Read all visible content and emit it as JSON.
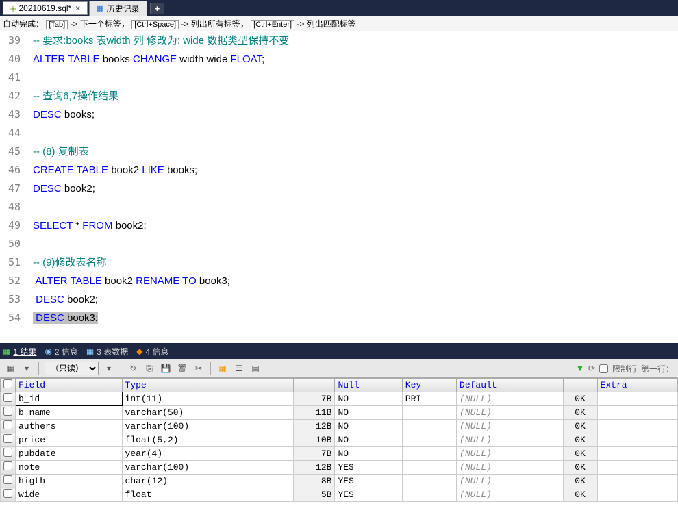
{
  "tabs": [
    {
      "label": "20210619.sql*",
      "icon": "◈",
      "iconColor": "#888"
    },
    {
      "label": "历史记录",
      "icon": "▦",
      "iconColor": "#2266cc"
    }
  ],
  "hintBar": {
    "prefix": "自动完成： ",
    "k1": "[Tab]",
    "t1": "-> 下一个标签， ",
    "k2": "[Ctrl+Space]",
    "t2": "-> 列出所有标签， ",
    "k3": "[Ctrl+Enter]",
    "t3": "-> 列出匹配标签"
  },
  "code": {
    "startLine": 39,
    "lines": [
      [
        {
          "c": "cm",
          "t": "-- 要求:books 表width 列 修改为: wide 数据类型保持不变"
        }
      ],
      [
        {
          "c": "kw",
          "t": "ALTER TABLE"
        },
        {
          "t": " books "
        },
        {
          "c": "kw",
          "t": "CHANGE"
        },
        {
          "t": " width wide "
        },
        {
          "c": "kw",
          "t": "FLOAT"
        },
        {
          "t": ";"
        }
      ],
      [],
      [
        {
          "c": "cm",
          "t": "-- 查询6,7操作结果"
        }
      ],
      [
        {
          "c": "kw",
          "t": "DESC"
        },
        {
          "t": " books;"
        }
      ],
      [],
      [
        {
          "c": "cm",
          "t": "-- (8) 复制表"
        }
      ],
      [
        {
          "c": "kw",
          "t": "CREATE TABLE"
        },
        {
          "t": " book2 "
        },
        {
          "c": "kw",
          "t": "LIKE"
        },
        {
          "t": " books;"
        }
      ],
      [
        {
          "c": "kw",
          "t": "DESC"
        },
        {
          "t": " book2;"
        }
      ],
      [],
      [
        {
          "c": "kw",
          "t": "SELECT"
        },
        {
          "t": " * "
        },
        {
          "c": "kw",
          "t": "FROM"
        },
        {
          "t": " book2;"
        }
      ],
      [],
      [
        {
          "c": "cm",
          "t": "-- (9)修改表名称"
        }
      ],
      [
        {
          "t": " "
        },
        {
          "c": "kw",
          "t": "ALTER TABLE"
        },
        {
          "t": " book2 "
        },
        {
          "c": "kw",
          "t": "RENAME TO"
        },
        {
          "t": " book3;"
        }
      ],
      [
        {
          "t": " "
        },
        {
          "c": "kw",
          "t": "DESC"
        },
        {
          "t": " book2;"
        }
      ],
      [
        {
          "hl": true,
          "parts": [
            {
              "t": " "
            },
            {
              "c": "kw",
              "t": "DESC"
            },
            {
              "t": " book3;"
            }
          ]
        }
      ]
    ]
  },
  "panelTabs": {
    "t1": "1 结果",
    "t2": "2 信息",
    "t3": "3 表数据",
    "t4": "4 信息"
  },
  "toolbar": {
    "readonly": "（只读）",
    "limitRow": "限制行",
    "firstRow": "第一行："
  },
  "grid": {
    "headers": [
      "Field",
      "Type",
      "",
      "Null",
      "Key",
      "Default",
      "",
      "Extra"
    ],
    "rows": [
      {
        "sel": true,
        "field": "b_id",
        "type": "int(11)",
        "size": "7B",
        "null": "NO",
        "key": "PRI",
        "def": "(NULL)",
        "ok": "0K",
        "extra": ""
      },
      {
        "field": "b_name",
        "type": "varchar(50)",
        "size": "11B",
        "null": "NO",
        "key": "",
        "def": "(NULL)",
        "ok": "0K",
        "extra": ""
      },
      {
        "field": "authers",
        "type": "varchar(100)",
        "size": "12B",
        "null": "NO",
        "key": "",
        "def": "(NULL)",
        "ok": "0K",
        "extra": ""
      },
      {
        "field": "price",
        "type": "float(5,2)",
        "size": "10B",
        "null": "NO",
        "key": "",
        "def": "(NULL)",
        "ok": "0K",
        "extra": ""
      },
      {
        "field": "pubdate",
        "type": "year(4)",
        "size": "7B",
        "null": "NO",
        "key": "",
        "def": "(NULL)",
        "ok": "0K",
        "extra": ""
      },
      {
        "field": "note",
        "type": "varchar(100)",
        "size": "12B",
        "null": "YES",
        "key": "",
        "def": "(NULL)",
        "ok": "0K",
        "extra": ""
      },
      {
        "field": "higth",
        "type": "char(12)",
        "size": "8B",
        "null": "YES",
        "key": "",
        "def": "(NULL)",
        "ok": "0K",
        "extra": ""
      },
      {
        "field": "wide",
        "type": "float",
        "size": "5B",
        "null": "YES",
        "key": "",
        "def": "(NULL)",
        "ok": "0K",
        "extra": ""
      }
    ]
  }
}
